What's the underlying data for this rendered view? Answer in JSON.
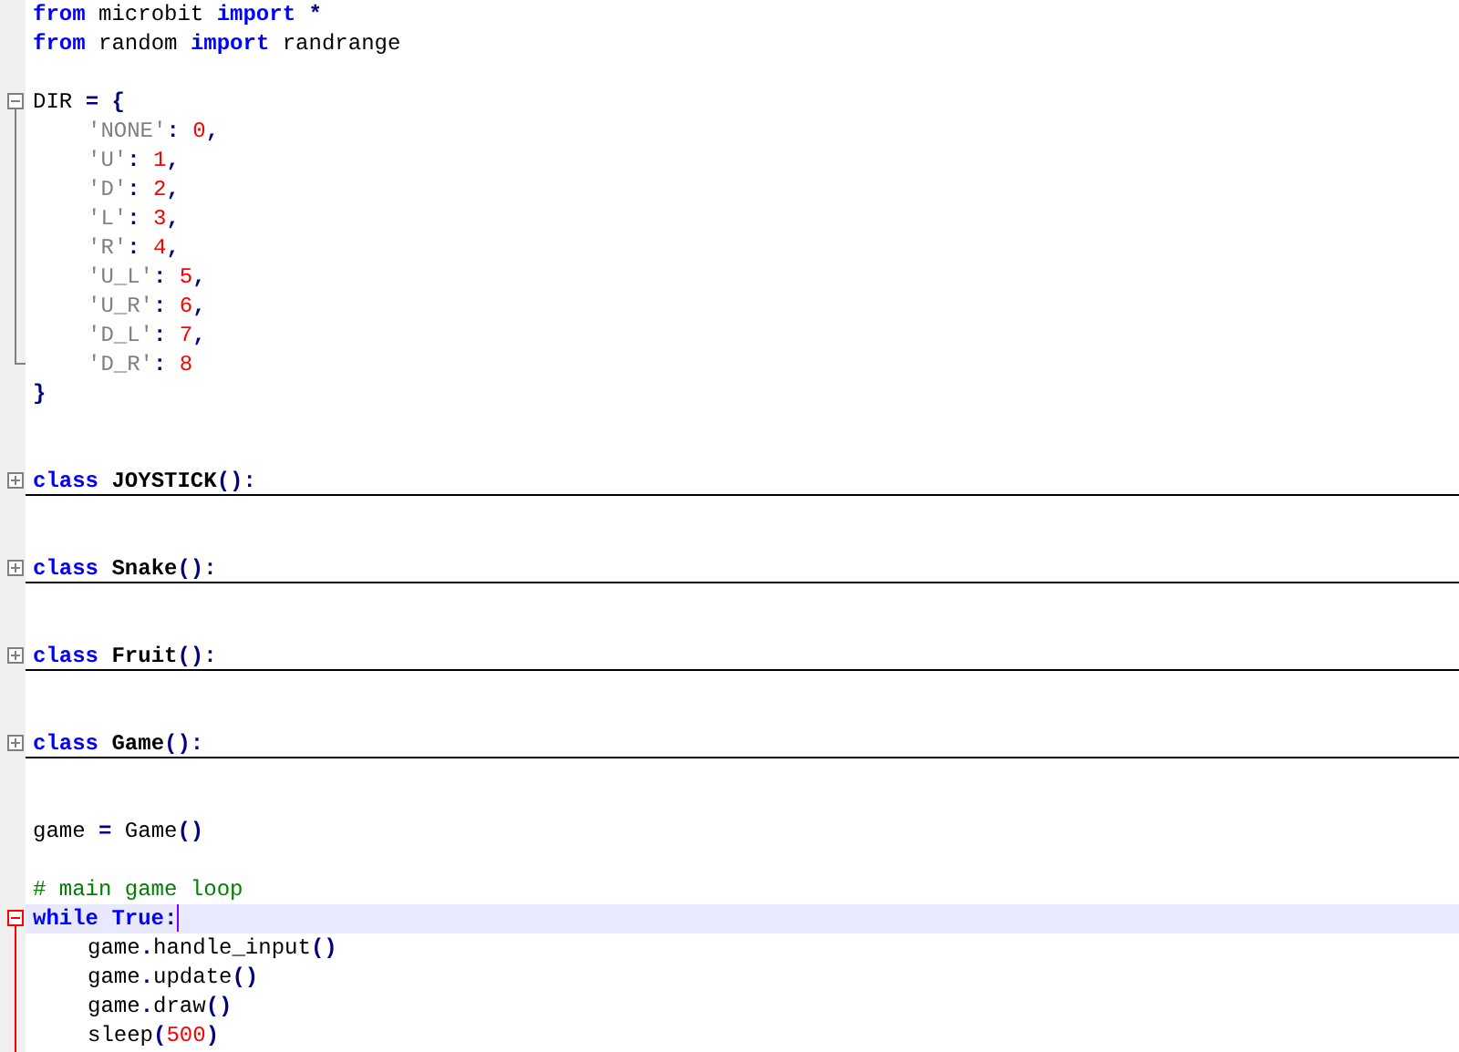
{
  "editor": {
    "lines": [
      {
        "tokens": [
          {
            "kind": "keyword",
            "text": "from "
          },
          {
            "kind": "plain",
            "text": "microbit "
          },
          {
            "kind": "keyword",
            "text": "import "
          },
          {
            "kind": "operator",
            "text": "*"
          }
        ]
      },
      {
        "tokens": [
          {
            "kind": "keyword",
            "text": "from "
          },
          {
            "kind": "plain",
            "text": "random "
          },
          {
            "kind": "keyword",
            "text": "import "
          },
          {
            "kind": "plain",
            "text": "randrange"
          }
        ]
      },
      {
        "blank": true
      },
      {
        "expanded": true,
        "active": false,
        "tokens": [
          {
            "kind": "plain",
            "text": "DIR "
          },
          {
            "kind": "operator",
            "text": "= {"
          }
        ],
        "children": [
          {
            "tokens": [
              {
                "kind": "string",
                "text": "'NONE'"
              },
              {
                "kind": "operator",
                "text": ": "
              },
              {
                "kind": "number",
                "text": "0"
              },
              {
                "kind": "operator",
                "text": ","
              }
            ]
          },
          {
            "tokens": [
              {
                "kind": "string",
                "text": "'U'"
              },
              {
                "kind": "operator",
                "text": ": "
              },
              {
                "kind": "number",
                "text": "1"
              },
              {
                "kind": "operator",
                "text": ","
              }
            ]
          },
          {
            "tokens": [
              {
                "kind": "string",
                "text": "'D'"
              },
              {
                "kind": "operator",
                "text": ": "
              },
              {
                "kind": "number",
                "text": "2"
              },
              {
                "kind": "operator",
                "text": ","
              }
            ]
          },
          {
            "tokens": [
              {
                "kind": "string",
                "text": "'L'"
              },
              {
                "kind": "operator",
                "text": ": "
              },
              {
                "kind": "number",
                "text": "3"
              },
              {
                "kind": "operator",
                "text": ","
              }
            ]
          },
          {
            "tokens": [
              {
                "kind": "string",
                "text": "'R'"
              },
              {
                "kind": "operator",
                "text": ": "
              },
              {
                "kind": "number",
                "text": "4"
              },
              {
                "kind": "operator",
                "text": ","
              }
            ]
          },
          {
            "tokens": [
              {
                "kind": "string",
                "text": "'U_L'"
              },
              {
                "kind": "operator",
                "text": ": "
              },
              {
                "kind": "number",
                "text": "5"
              },
              {
                "kind": "operator",
                "text": ","
              }
            ]
          },
          {
            "tokens": [
              {
                "kind": "string",
                "text": "'U_R'"
              },
              {
                "kind": "operator",
                "text": ": "
              },
              {
                "kind": "number",
                "text": "6"
              },
              {
                "kind": "operator",
                "text": ","
              }
            ]
          },
          {
            "tokens": [
              {
                "kind": "string",
                "text": "'D_L'"
              },
              {
                "kind": "operator",
                "text": ": "
              },
              {
                "kind": "number",
                "text": "7"
              },
              {
                "kind": "operator",
                "text": ","
              }
            ]
          },
          {
            "tokens": [
              {
                "kind": "string",
                "text": "'D_R'"
              },
              {
                "kind": "operator",
                "text": ": "
              },
              {
                "kind": "number",
                "text": "8"
              }
            ]
          }
        ]
      },
      {
        "tokens": [
          {
            "kind": "operator",
            "text": "}"
          }
        ]
      },
      {
        "blank": true
      },
      {
        "blank": true
      },
      {
        "expanded": false,
        "active": false,
        "tokens": [
          {
            "kind": "keyword",
            "text": "class "
          },
          {
            "kind": "classname",
            "text": "JOYSTICK"
          },
          {
            "kind": "operator",
            "text": "():"
          }
        ]
      },
      {
        "blank": true
      },
      {
        "blank": true
      },
      {
        "expanded": false,
        "active": false,
        "tokens": [
          {
            "kind": "keyword",
            "text": "class "
          },
          {
            "kind": "classname",
            "text": "Snake"
          },
          {
            "kind": "operator",
            "text": "():"
          }
        ]
      },
      {
        "blank": true
      },
      {
        "blank": true
      },
      {
        "expanded": false,
        "active": false,
        "tokens": [
          {
            "kind": "keyword",
            "text": "class "
          },
          {
            "kind": "classname",
            "text": "Fruit"
          },
          {
            "kind": "operator",
            "text": "():"
          }
        ]
      },
      {
        "blank": true
      },
      {
        "blank": true
      },
      {
        "expanded": false,
        "active": false,
        "tokens": [
          {
            "kind": "keyword",
            "text": "class "
          },
          {
            "kind": "classname",
            "text": "Game"
          },
          {
            "kind": "operator",
            "text": "():"
          }
        ]
      },
      {
        "blank": true
      },
      {
        "blank": true
      },
      {
        "tokens": [
          {
            "kind": "plain",
            "text": "game "
          },
          {
            "kind": "operator",
            "text": "= "
          },
          {
            "kind": "plain",
            "text": "Game"
          },
          {
            "kind": "operator",
            "text": "()"
          }
        ]
      },
      {
        "blank": true
      },
      {
        "tokens": [
          {
            "kind": "comment",
            "text": "# main game loop"
          }
        ]
      },
      {
        "expanded": true,
        "active": true,
        "current": true,
        "tokens": [
          {
            "kind": "keyword",
            "text": "while True"
          },
          {
            "kind": "operator",
            "text": ":"
          }
        ],
        "children": [
          {
            "tokens": [
              {
                "kind": "plain",
                "text": "game"
              },
              {
                "kind": "operator",
                "text": "."
              },
              {
                "kind": "plain",
                "text": "handle_input"
              },
              {
                "kind": "operator",
                "text": "()"
              }
            ]
          },
          {
            "tokens": [
              {
                "kind": "plain",
                "text": "game"
              },
              {
                "kind": "operator",
                "text": "."
              },
              {
                "kind": "plain",
                "text": "update"
              },
              {
                "kind": "operator",
                "text": "()"
              }
            ]
          },
          {
            "tokens": [
              {
                "kind": "plain",
                "text": "game"
              },
              {
                "kind": "operator",
                "text": "."
              },
              {
                "kind": "plain",
                "text": "draw"
              },
              {
                "kind": "operator",
                "text": "()"
              }
            ]
          },
          {
            "tokens": [
              {
                "kind": "plain",
                "text": "sleep"
              },
              {
                "kind": "operator",
                "text": "("
              },
              {
                "kind": "number",
                "text": "500"
              },
              {
                "kind": "operator",
                "text": ")"
              }
            ]
          }
        ]
      }
    ]
  }
}
